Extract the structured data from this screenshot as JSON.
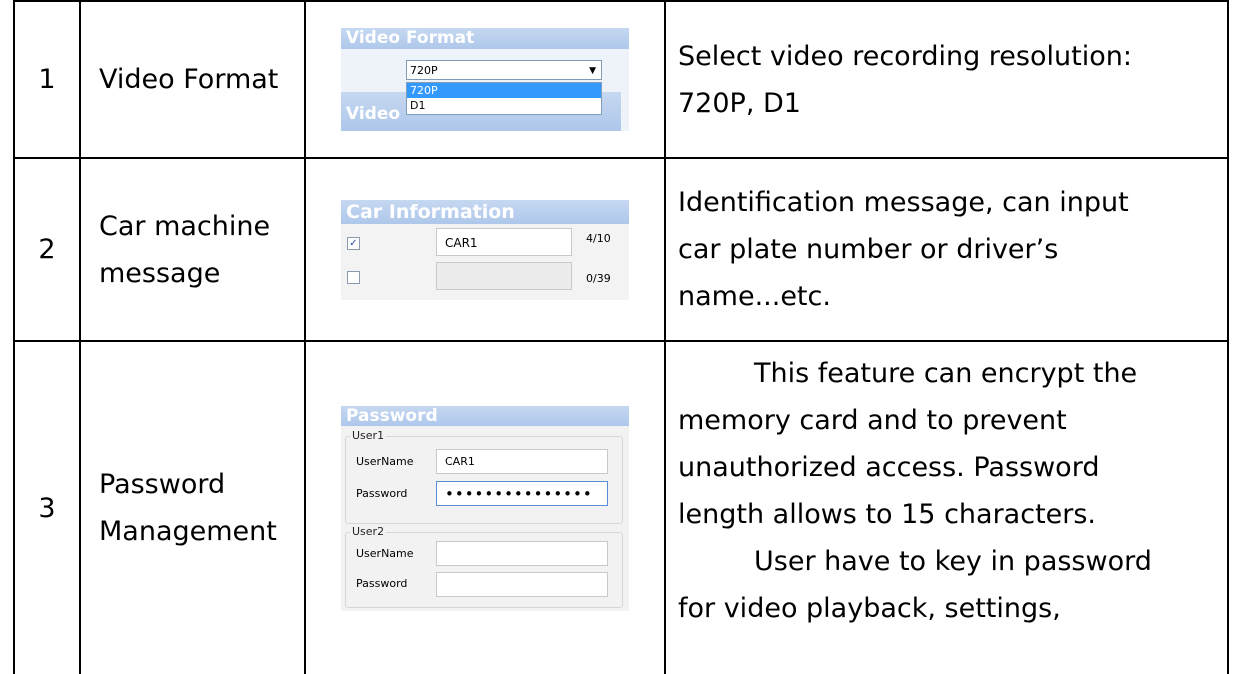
{
  "rows": [
    {
      "num": "1",
      "name": "Video Format",
      "desc_lines": [
        "Select video recording resolution:",
        "720P, D1"
      ],
      "ui": {
        "header": "Video Format",
        "selected": "720P",
        "options": [
          "720P",
          "D1"
        ],
        "second_header": "Video"
      }
    },
    {
      "num": "2",
      "name_lines": [
        "Car machine",
        "message"
      ],
      "desc_lines": [
        "Identification message, can input",
        "car plate number or driver’s",
        "name...etc."
      ],
      "ui": {
        "header": "Car Information",
        "field1_value": "CAR1",
        "field1_checked": true,
        "field1_count": "4/10",
        "field2_value": "",
        "field2_checked": false,
        "field2_count": "0/39"
      }
    },
    {
      "num": "3",
      "name_lines": [
        "Password",
        "Management"
      ],
      "desc_lines": [
        "This feature can encrypt the",
        "memory card and to prevent",
        "unauthorized access.  Password",
        "length allows to 15 characters.",
        "User have to key in password",
        "for video playback, settings,"
      ],
      "ui": {
        "header": "Password",
        "user1_label": "User1",
        "user2_label": "User2",
        "username_label": "UserName",
        "password_label": "Password",
        "user1_username": "CAR1",
        "user1_password": "•••••••••••••••",
        "user2_username": "",
        "user2_password": ""
      }
    }
  ]
}
